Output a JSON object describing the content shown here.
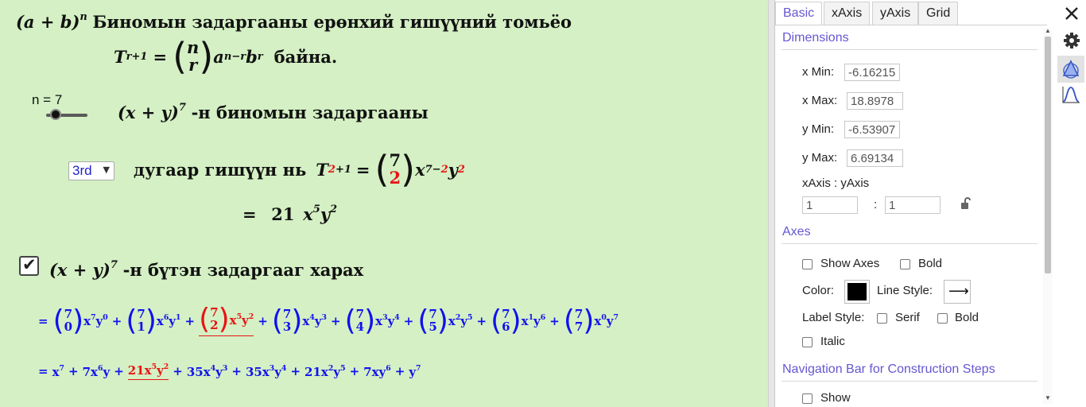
{
  "header": {
    "title_math": "(a + b)",
    "title_exp": "n",
    "title_text": "Биномын задаргааны ерөнхий гишүүний томьёо",
    "formula_T": "T",
    "formula_sub": "r+1",
    "formula_eq": "=",
    "formula_binom_top": "n",
    "formula_binom_bottom": "r",
    "formula_a": "a",
    "formula_a_exp": "n−r",
    "formula_b": "b",
    "formula_b_exp": "r",
    "formula_tail": "байна."
  },
  "slider": {
    "label": "n = 7",
    "value": 7
  },
  "expansion_caption": {
    "math": "(x + y)",
    "exp": "7",
    "text": "-н биномын задаргааны"
  },
  "term_select": {
    "selected": "3rd",
    "text": "дугаар гишүүн нь",
    "T": "T",
    "sub_r": "2",
    "sub_rest": "+1",
    "eq": "=",
    "binom_top": "7",
    "binom_bottom": "2",
    "x": "x",
    "x_exp_base": "7−",
    "x_exp_r": "2",
    "y": "y",
    "y_exp": "2",
    "result_eq": "=",
    "result_coef": "21",
    "result_x": "x",
    "result_x_exp": "5",
    "result_y": "y",
    "result_y_exp": "2"
  },
  "full_expansion": {
    "checked": true,
    "math": "(x + y)",
    "exp": "7",
    "text": "-н бүтэн задаргааг харах",
    "eq": "=",
    "plus": "+",
    "terms": [
      {
        "top": "7",
        "bot": "0",
        "xe": "7",
        "ye": "0"
      },
      {
        "top": "7",
        "bot": "1",
        "xe": "6",
        "ye": "1"
      },
      {
        "top": "7",
        "bot": "2",
        "xe": "5",
        "ye": "2"
      },
      {
        "top": "7",
        "bot": "3",
        "xe": "4",
        "ye": "3"
      },
      {
        "top": "7",
        "bot": "4",
        "xe": "3",
        "ye": "4"
      },
      {
        "top": "7",
        "bot": "5",
        "xe": "2",
        "ye": "5"
      },
      {
        "top": "7",
        "bot": "6",
        "xe": "1",
        "ye": "6"
      },
      {
        "top": "7",
        "bot": "7",
        "xe": "0",
        "ye": "7"
      }
    ],
    "line2": [
      {
        "c": "",
        "x": "x",
        "xe": "7",
        "y": "",
        "ye": ""
      },
      {
        "c": "7",
        "x": "x",
        "xe": "6",
        "y": "y",
        "ye": ""
      },
      {
        "c": "21",
        "x": "x",
        "xe": "5",
        "y": "y",
        "ye": "2"
      },
      {
        "c": "35",
        "x": "x",
        "xe": "4",
        "y": "y",
        "ye": "3"
      },
      {
        "c": "35",
        "x": "x",
        "xe": "3",
        "y": "y",
        "ye": "4"
      },
      {
        "c": "21",
        "x": "x",
        "xe": "2",
        "y": "y",
        "ye": "5"
      },
      {
        "c": "7",
        "x": "x",
        "xe": "",
        "y": "y",
        "ye": "6"
      },
      {
        "c": "",
        "x": "",
        "xe": "",
        "y": "y",
        "ye": "7"
      }
    ],
    "highlight_index": 2
  },
  "panel": {
    "tabs": [
      "Basic",
      "xAxis",
      "yAxis",
      "Grid"
    ],
    "dimensions_title": "Dimensions",
    "xmin_label": "x Min:",
    "xmin_value": "-6.16215",
    "xmax_label": "x Max:",
    "xmax_value": "18.8978",
    "ymin_label": "y Min:",
    "ymin_value": "-6.53907",
    "ymax_label": "y Max:",
    "ymax_value": "6.69134",
    "ratio_label": "xAxis : yAxis",
    "ratio_x": "1",
    "ratio_sep": ":",
    "ratio_y": "1",
    "axes_title": "Axes",
    "show_axes": "Show Axes",
    "bold": "Bold",
    "color_label": "Color:",
    "line_style_label": "Line Style:",
    "label_style": "Label Style:",
    "serif": "Serif",
    "bold2": "Bold",
    "italic": "Italic",
    "nav_title": "Navigation Bar for Construction Steps",
    "show": "Show",
    "axis_color": "#000000"
  }
}
